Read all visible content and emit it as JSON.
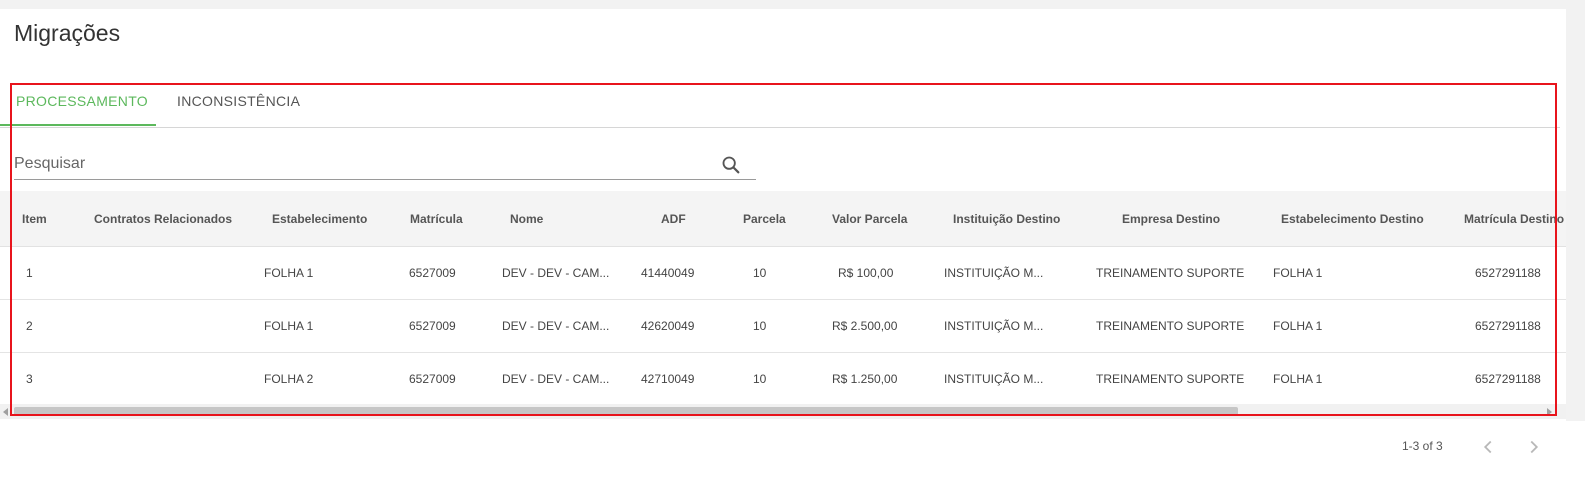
{
  "page": {
    "title": "Migrações"
  },
  "tabs": [
    {
      "label": "PROCESSAMENTO",
      "active": true
    },
    {
      "label": "INCONSISTÊNCIA",
      "active": false
    }
  ],
  "search": {
    "placeholder": "Pesquisar",
    "value": "",
    "icon": "search-icon"
  },
  "table": {
    "columns": [
      "Item",
      "Contratos Relacionados",
      "Estabelecimento",
      "Matrícula",
      "Nome",
      "ADF",
      "Parcela",
      "Valor Parcela",
      "Instituição Destino",
      "Empresa Destino",
      "Estabelecimento Destino",
      "Matrícula Destino"
    ],
    "rows": [
      {
        "item": "1",
        "contratos": "",
        "estabelecimento": "FOLHA 1",
        "matricula": "6527009",
        "nome": "DEV - DEV - CAM...",
        "adf": "41440049",
        "parcela": "10",
        "valor": "R$ 100,00",
        "instituicao": "INSTITUIÇÃO M...",
        "empresa": "TREINAMENTO SUPORTE",
        "estab_destino": "FOLHA 1",
        "matricula_destino": "6527291188"
      },
      {
        "item": "2",
        "contratos": "",
        "estabelecimento": "FOLHA 1",
        "matricula": "6527009",
        "nome": "DEV - DEV - CAM...",
        "adf": "42620049",
        "parcela": "10",
        "valor": "R$ 2.500,00",
        "instituicao": "INSTITUIÇÃO M...",
        "empresa": "TREINAMENTO SUPORTE",
        "estab_destino": "FOLHA 1",
        "matricula_destino": "6527291188"
      },
      {
        "item": "3",
        "contratos": "",
        "estabelecimento": "FOLHA 2",
        "matricula": "6527009",
        "nome": "DEV - DEV - CAM...",
        "adf": "42710049",
        "parcela": "10",
        "valor": "R$ 1.250,00",
        "instituicao": "INSTITUIÇÃO M...",
        "empresa": "TREINAMENTO SUPORTE",
        "estab_destino": "FOLHA 1",
        "matricula_destino": "6527291188"
      }
    ]
  },
  "paginator": {
    "range_label": "1-3 of 3",
    "prev_icon": "chevron-left-icon",
    "next_icon": "chevron-right-icon"
  },
  "colors": {
    "accent": "#5cb85c",
    "highlight": "#e8141c"
  }
}
